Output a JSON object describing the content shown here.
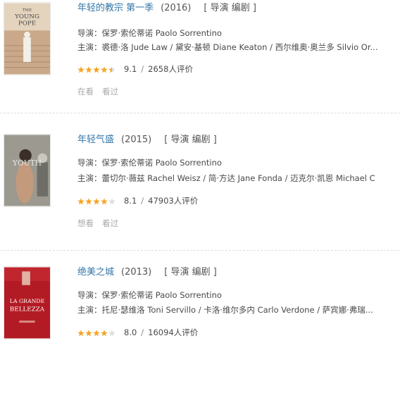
{
  "movies": [
    {
      "title": "年轻的教宗 第一季",
      "year": "(2016)",
      "roles": "[ 导演 编剧 ]",
      "director": "导演：保罗·索伦蒂诺 Paolo Sorrentino",
      "cast": "主演：裘德·洛 Jude Law / 黛安·基顿 Diane Keaton / 西尔维奥·奥兰多 Silvio Or...",
      "stars": 4.5,
      "score": "9.1",
      "separator": "/",
      "votes": "2658人评价",
      "actions": [
        "在看",
        "看过"
      ],
      "poster_text": [
        "THE",
        "YOUNG",
        "POPE"
      ]
    },
    {
      "title": "年轻气盛",
      "year": "(2015)",
      "roles": "[ 导演 编剧 ]",
      "director": "导演：保罗·索伦蒂诺 Paolo Sorrentino",
      "cast": "主演：蕾切尔·薇兹 Rachel Weisz / 简·方达 Jane Fonda / 迈克尔·凯恩 Michael C",
      "stars": 4,
      "score": "8.1",
      "separator": "/",
      "votes": "47903人评价",
      "actions": [
        "想看",
        "看过"
      ],
      "poster_text": [
        "YOUTH"
      ]
    },
    {
      "title": "绝美之城",
      "year": "(2013)",
      "roles": "[ 导演 编剧 ]",
      "director": "导演：保罗·索伦蒂诺 Paolo Sorrentino",
      "cast": "主演：托尼·瑟维洛 Toni Servillo / 卡洛·维尔多内 Carlo Verdone / 萨宾娜·弗瑞...",
      "stars": 4,
      "score": "8.0",
      "separator": "/",
      "votes": "16094人评价",
      "actions": [],
      "poster_text": [
        "LA GRANDE",
        "BELLEZZA"
      ]
    }
  ],
  "colors": {
    "title_link": "#3377aa",
    "star_filled": "#f5a623",
    "star_empty": "#dddddd",
    "action_text": "#aaaaaa"
  }
}
